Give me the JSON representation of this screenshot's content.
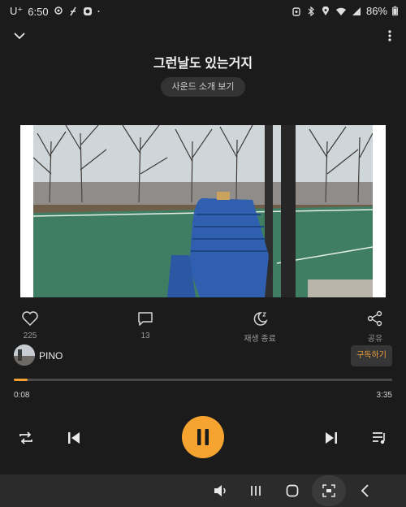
{
  "status_bar": {
    "carrier": "U⁺",
    "time": "6:50",
    "battery": "86%",
    "left_icons": [
      "location-icon",
      "ev-icon",
      "app-icon",
      "dot"
    ],
    "right_icons": [
      "alarm-icon",
      "bluetooth-icon",
      "location-icon",
      "wifi-icon",
      "signal-icon",
      "battery-icon"
    ]
  },
  "header": {
    "title": "그런날도 있는거지",
    "sound_intro_label": "사운드 소개 보기"
  },
  "actions": {
    "like_count": "225",
    "comment_count": "13",
    "sleep_label": "재생 종료",
    "share_label": "공유"
  },
  "channel": {
    "name": "PINO",
    "subscribe_label": "구독하기"
  },
  "player": {
    "current_time": "0:08",
    "total_time": "3:35",
    "progress": 0.037,
    "state": "playing"
  },
  "colors": {
    "accent": "#f6a330",
    "background": "#1b1b1b"
  }
}
